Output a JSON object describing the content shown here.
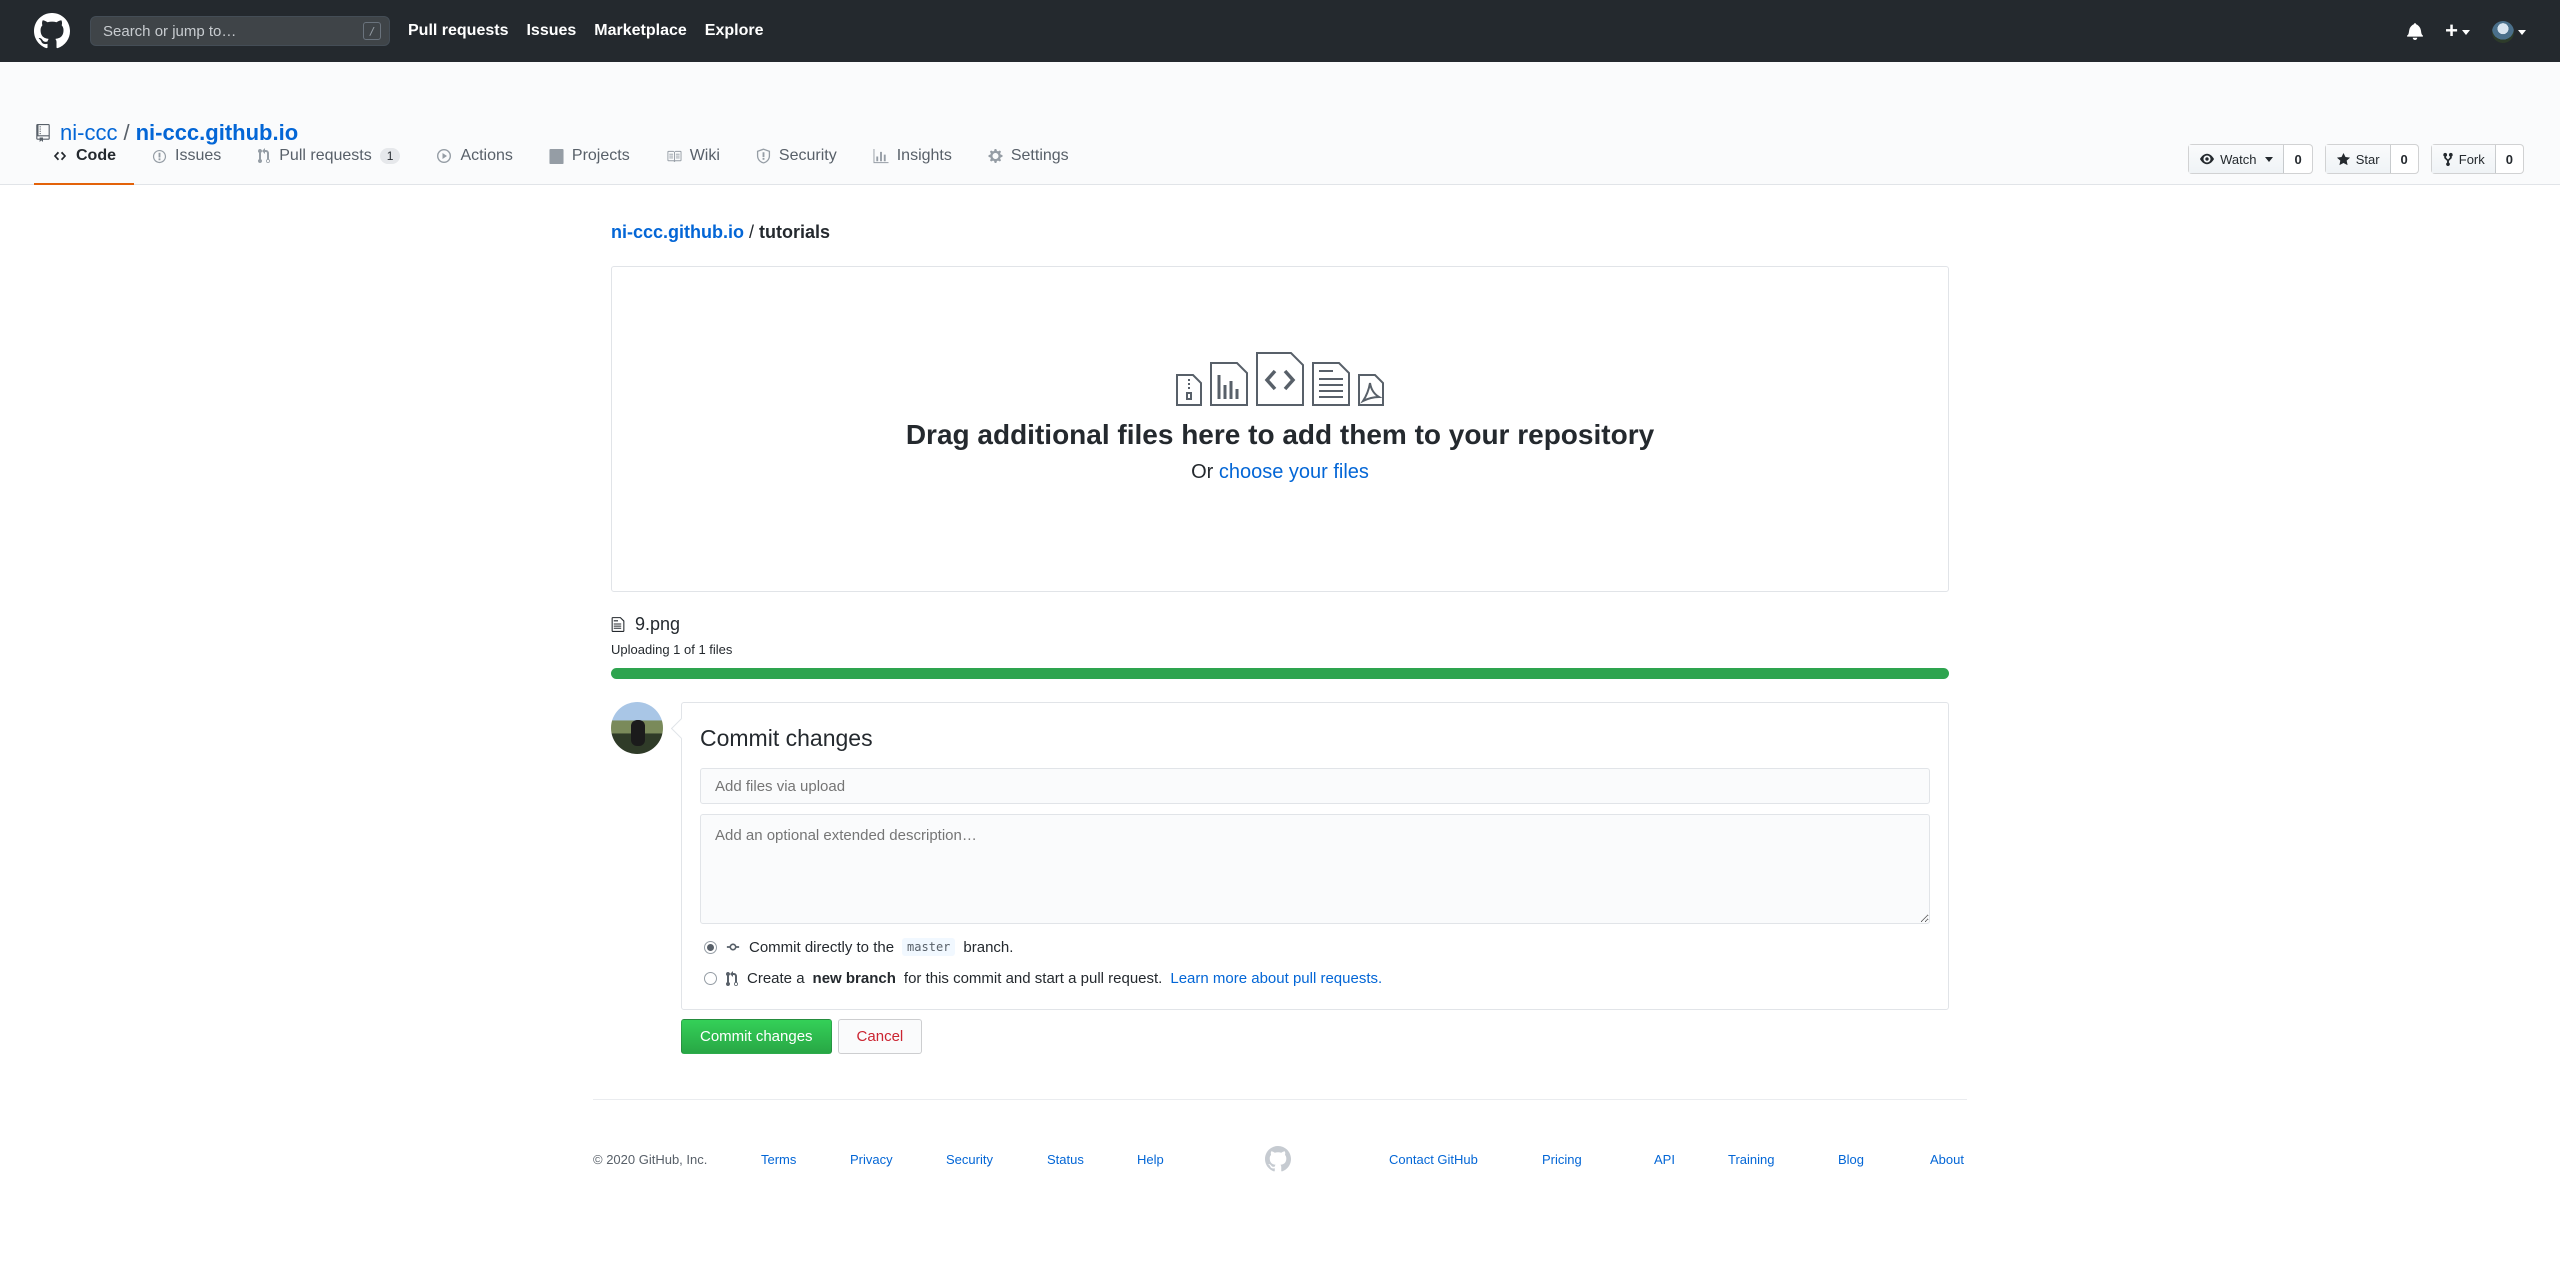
{
  "header": {
    "search_placeholder": "Search or jump to…",
    "search_shortcut": "/",
    "nav": [
      "Pull requests",
      "Issues",
      "Marketplace",
      "Explore"
    ],
    "add_label": "+"
  },
  "repo": {
    "owner": "ni-ccc",
    "separator": "/",
    "name": "ni-ccc.github.io",
    "watch": {
      "label": "Watch",
      "count": "0"
    },
    "star": {
      "label": "Star",
      "count": "0"
    },
    "fork": {
      "label": "Fork",
      "count": "0"
    },
    "tabs": [
      {
        "label": "Code",
        "icon": "code-icon",
        "selected": true
      },
      {
        "label": "Issues",
        "icon": "issue-icon"
      },
      {
        "label": "Pull requests",
        "icon": "pull-request-icon",
        "counter": "1"
      },
      {
        "label": "Actions",
        "icon": "play-icon"
      },
      {
        "label": "Projects",
        "icon": "project-icon"
      },
      {
        "label": "Wiki",
        "icon": "book-icon"
      },
      {
        "label": "Security",
        "icon": "shield-icon"
      },
      {
        "label": "Insights",
        "icon": "graph-icon"
      },
      {
        "label": "Settings",
        "icon": "gear-icon"
      }
    ]
  },
  "upload": {
    "breadcrumb_root": "ni-ccc.github.io",
    "breadcrumb_sep": "/",
    "breadcrumb_current": "tutorials",
    "drop_title": "Drag additional files here to add them to your repository",
    "drop_or": "Or",
    "choose_files": "choose your files",
    "file_name": "9.png",
    "status": "Uploading 1 of 1 files",
    "progress_fraction": 1.0,
    "progress_color": "#2ea44f"
  },
  "commit": {
    "title": "Commit changes",
    "summary_placeholder": "Add files via upload",
    "description_placeholder": "Add an optional extended description…",
    "option_direct_pre": "Commit directly to the",
    "branch": "master",
    "option_direct_post": "branch.",
    "option_new_pre": "Create a",
    "option_new_bold": "new branch",
    "option_new_post": "for this commit and start a pull request.",
    "learn_more": "Learn more about pull requests.",
    "submit": "Commit changes",
    "cancel": "Cancel"
  },
  "footer": {
    "copyright": "© 2020 GitHub, Inc.",
    "left_links": [
      "Terms",
      "Privacy",
      "Security",
      "Status",
      "Help"
    ],
    "right_links": [
      "Contact GitHub",
      "Pricing",
      "API",
      "Training",
      "Blog",
      "About"
    ]
  }
}
